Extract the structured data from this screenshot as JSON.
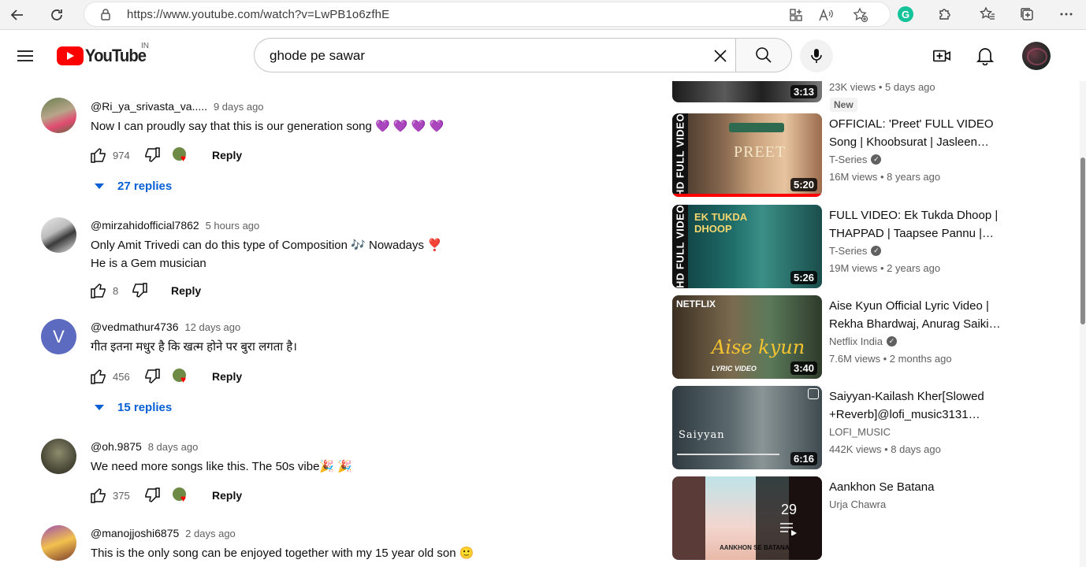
{
  "browser": {
    "url": "https://www.youtube.com/watch?v=LwPB1o6zfhE"
  },
  "header": {
    "logo_text": "YouTube",
    "country_code": "IN",
    "search_query": "ghode pe sawar"
  },
  "comments": [
    {
      "author": "@Ri_ya_srivasta_va.....",
      "time": "9 days ago",
      "lines": [
        "Now I can proudly say that this is our generation song 💜 💜 💜 💜"
      ],
      "likes": "974",
      "creator_heart": true,
      "reply_label": "Reply",
      "replies_label": "27 replies"
    },
    {
      "author": "@mirzahidofficial7862",
      "time": "5 hours ago",
      "lines": [
        "Only Amit Trivedi can do this type of Composition 🎶 Nowadays ❣️",
        "He is a Gem musician"
      ],
      "likes": "8",
      "creator_heart": false,
      "reply_label": "Reply",
      "replies_label": ""
    },
    {
      "author": "@vedmathur4736",
      "time": "12 days ago",
      "avatar_letter": "V",
      "lines": [
        "गीत इतना मधुर है कि खत्म होने पर बुरा लगता है।"
      ],
      "likes": "456",
      "creator_heart": true,
      "reply_label": "Reply",
      "replies_label": "15 replies"
    },
    {
      "author": "@oh.9875",
      "time": "8 days ago",
      "lines": [
        "We need more songs like this. The 50s vibe🎉 🎉"
      ],
      "likes": "375",
      "creator_heart": true,
      "reply_label": "Reply",
      "replies_label": ""
    },
    {
      "author": "@manojjoshi6875",
      "time": "2 days ago",
      "lines": [
        "This is the only song can be enjoyed together with my 15 year old son 🙂"
      ],
      "likes": "",
      "creator_heart": false,
      "reply_label": "",
      "replies_label": ""
    }
  ],
  "sidebar": [
    {
      "title": "",
      "channel": "",
      "meta": "23K views • 5 days ago",
      "badge": "New",
      "duration": "3:13"
    },
    {
      "title": "OFFICIAL: 'Preet' FULL VIDEO Song | Khoobsurat | Jasleen…",
      "channel": "T-Series",
      "meta": "16M views • 8 years ago",
      "duration": "5:20",
      "thumb_text": "PREET",
      "strip": "HD FULL VIDEO"
    },
    {
      "title": "FULL VIDEO: Ek Tukda Dhoop | THAPPAD | Taapsee Pannu |…",
      "channel": "T-Series",
      "meta": "19M views • 2 years ago",
      "duration": "5:26",
      "thumb_text": "EK TUKDA DHOOP",
      "strip": "HD FULL VIDEO"
    },
    {
      "title": "Aise Kyun Official Lyric Video | Rekha Bhardwaj, Anurag Saiki…",
      "channel": "Netflix India",
      "meta": "7.6M views • 2 months ago",
      "duration": "3:40",
      "thumb_text": "Aise kyun",
      "thumb_brand": "NETFLIX",
      "thumb_sub": "LYRIC VIDEO"
    },
    {
      "title": "Saiyyan-Kailash Kher[Slowed +Reverb]@lofi_music3131…",
      "channel": "LOFI_MUSIC",
      "meta": "442K views • 8 days ago",
      "duration": "6:16",
      "thumb_text": "Saiyyan"
    },
    {
      "title": "Aankhon Se Batana",
      "channel": "Urja Chawra",
      "meta": "",
      "playlist_count": "29",
      "thumb_text": "AANKHON SE BATANA"
    }
  ]
}
